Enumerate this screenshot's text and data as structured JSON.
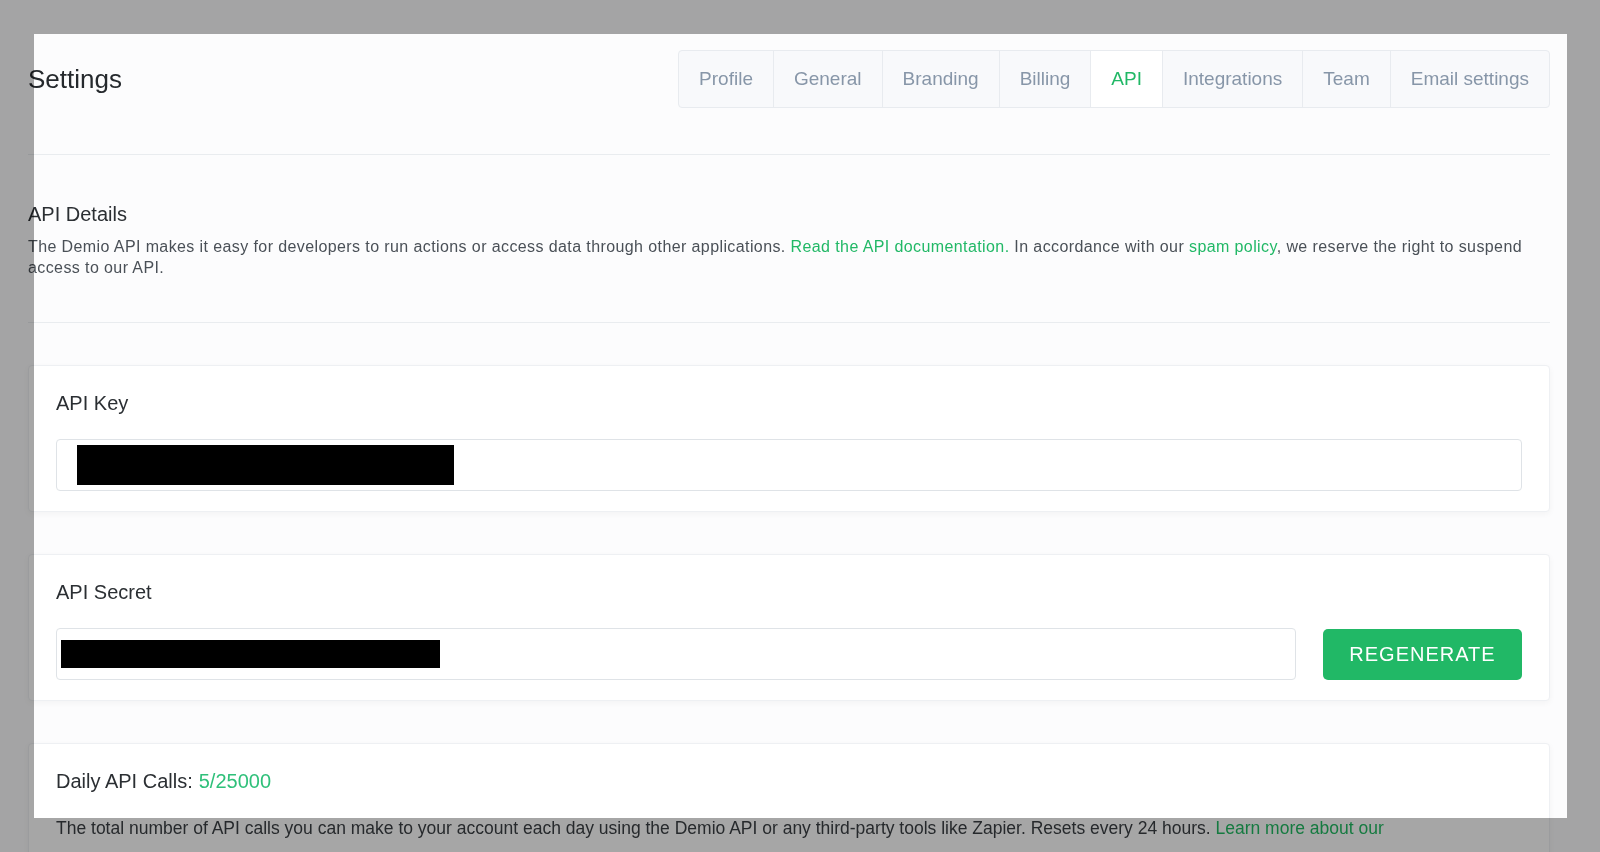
{
  "header": {
    "title": "Settings"
  },
  "tabs": [
    {
      "label": "Profile",
      "selected": false
    },
    {
      "label": "General",
      "selected": false
    },
    {
      "label": "Branding",
      "selected": false
    },
    {
      "label": "Billing",
      "selected": false
    },
    {
      "label": "API",
      "selected": true
    },
    {
      "label": "Integrations",
      "selected": false
    },
    {
      "label": "Team",
      "selected": false
    },
    {
      "label": "Email settings",
      "selected": false
    }
  ],
  "api_details": {
    "heading": "API Details",
    "text_before": "The Demio API makes it easy for developers to run actions or access data through other applications.",
    "link_1": "Read the API documentation.",
    "text_middle": "In accordance with our",
    "link_2": "spam policy",
    "text_after": ", we reserve the right to suspend access to our API."
  },
  "api_key": {
    "label": "API Key"
  },
  "api_secret": {
    "label": "API Secret",
    "button": "REGENERATE"
  },
  "daily_calls": {
    "label": "Daily API Calls:",
    "count": "5/25000",
    "text": "The total number of API calls you can make to your account each day using the Demio API or any third-party tools like Zapier. Resets every 24 hours.",
    "link": "Learn more about our"
  }
}
